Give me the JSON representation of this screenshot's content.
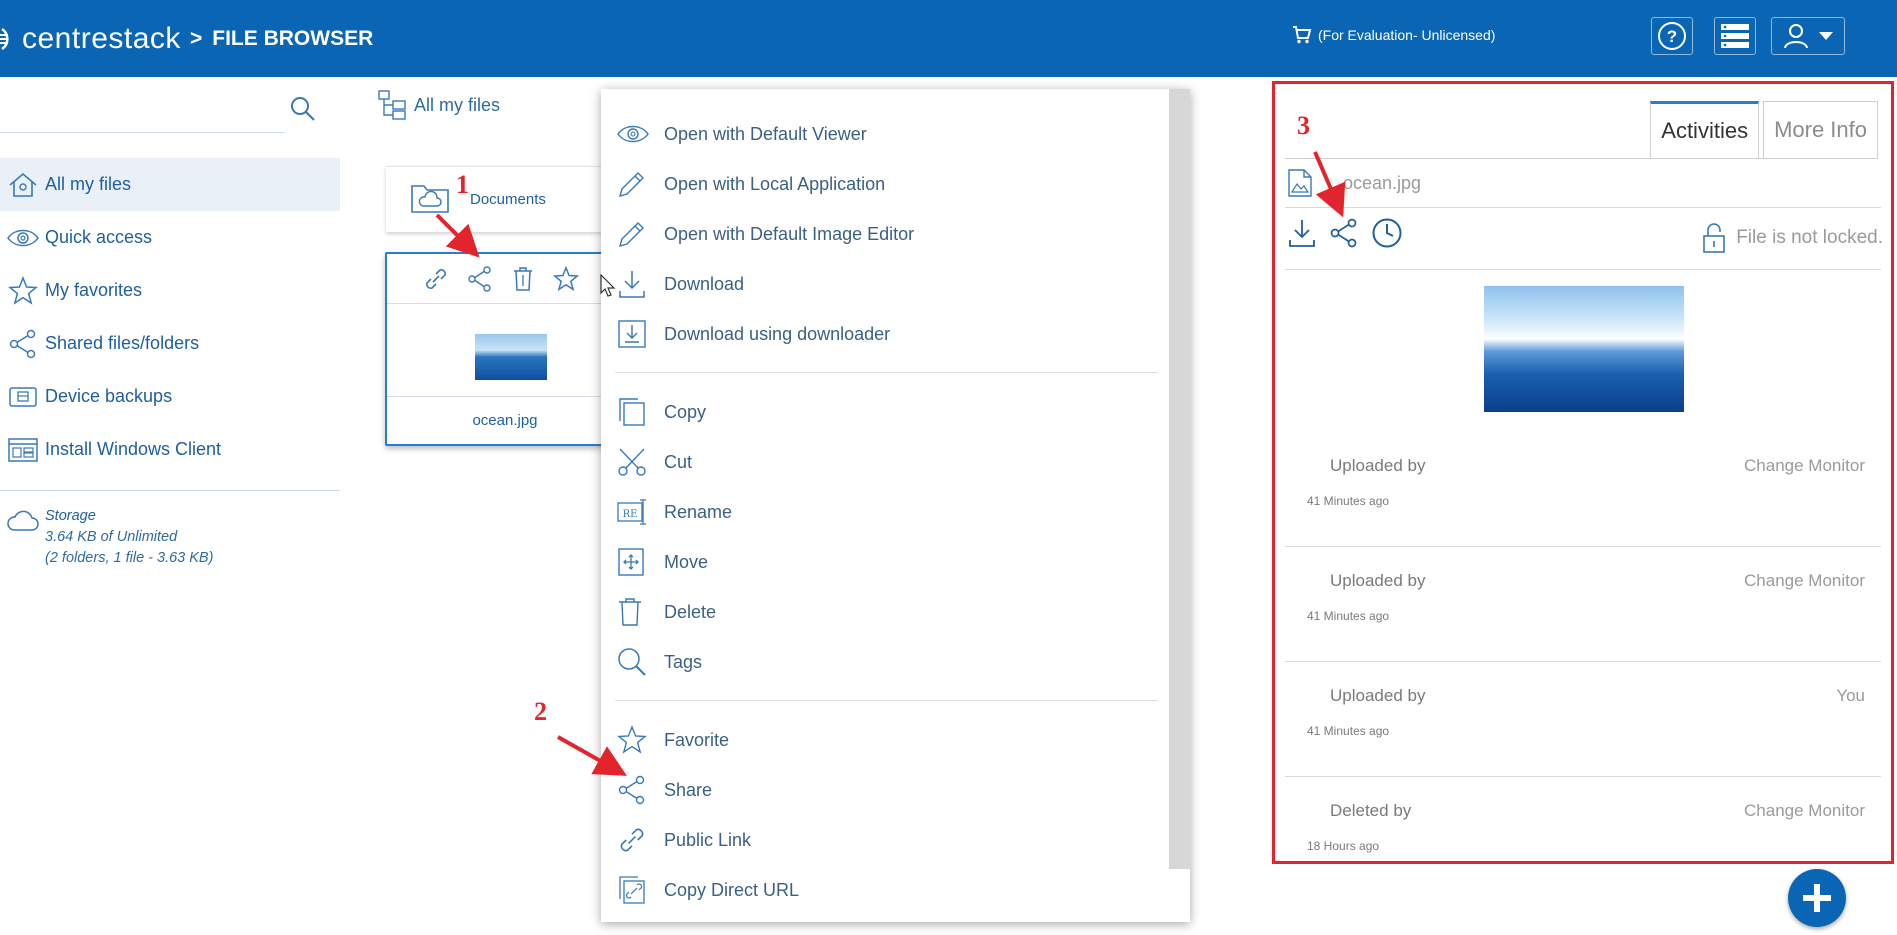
{
  "header": {
    "logo_text": "centrestack",
    "breadcrumb_sep": ">",
    "breadcrumb_title": "FILE BROWSER",
    "evaluation": "(For Evaluation- Unlicensed)",
    "help_label": "?"
  },
  "sidebar": {
    "search_placeholder": "",
    "items": [
      {
        "label": "All my files",
        "icon": "home-icon",
        "active": true
      },
      {
        "label": "Quick access",
        "icon": "eye-icon"
      },
      {
        "label": "My favorites",
        "icon": "star-icon"
      },
      {
        "label": "Shared files/folders",
        "icon": "share-icon"
      },
      {
        "label": "Device backups",
        "icon": "backup-icon"
      },
      {
        "label": "Install Windows Client",
        "icon": "windows-client-icon"
      }
    ],
    "storage": {
      "title": "Storage",
      "usage": "3.64 KB of Unlimited",
      "detail": "(2 folders, 1 file - 3.63 KB)"
    }
  },
  "browser": {
    "breadcrumb": "All my files",
    "folder_name": "Documents",
    "file_name": "ocean.jpg"
  },
  "context_menu": {
    "group1": [
      {
        "label": "Open with Default Viewer",
        "icon": "eye-icon"
      },
      {
        "label": "Open with Local Application",
        "icon": "pencil-icon"
      },
      {
        "label": "Open with Default Image Editor",
        "icon": "pencil-icon"
      },
      {
        "label": "Download",
        "icon": "download-icon"
      },
      {
        "label": "Download using downloader",
        "icon": "downloader-icon"
      }
    ],
    "group2": [
      {
        "label": "Copy",
        "icon": "copy-icon"
      },
      {
        "label": "Cut",
        "icon": "scissors-icon"
      },
      {
        "label": "Rename",
        "icon": "rename-icon"
      },
      {
        "label": "Move",
        "icon": "move-icon"
      },
      {
        "label": "Delete",
        "icon": "trash-icon"
      },
      {
        "label": "Tags",
        "icon": "tag-search-icon"
      }
    ],
    "group3": [
      {
        "label": "Favorite",
        "icon": "star-icon"
      },
      {
        "label": "Share",
        "icon": "share-icon"
      },
      {
        "label": "Public Link",
        "icon": "link-icon"
      },
      {
        "label": "Copy Direct URL",
        "icon": "direct-url-icon"
      }
    ]
  },
  "right_panel": {
    "tab_activities": "Activities",
    "tab_more_info": "More Info",
    "file_name": "ocean.jpg",
    "lock_status": "File is not locked.",
    "activities": [
      {
        "label": "Uploaded by",
        "who": "Change Monitor",
        "time": "41 Minutes ago"
      },
      {
        "label": "Uploaded by",
        "who": "Change Monitor",
        "time": "41 Minutes ago"
      },
      {
        "label": "Uploaded by",
        "who": "You",
        "time": "41 Minutes ago"
      },
      {
        "label": "Deleted by",
        "who": "Change Monitor",
        "time": "18 Hours ago"
      }
    ]
  },
  "annotations": {
    "n1": "1",
    "n2": "2",
    "n3": "3",
    "color": "#e2242c"
  },
  "colors": {
    "brand": "#0a65b4",
    "link": "#1f5fa0",
    "highlight_border": "#e2242c"
  }
}
